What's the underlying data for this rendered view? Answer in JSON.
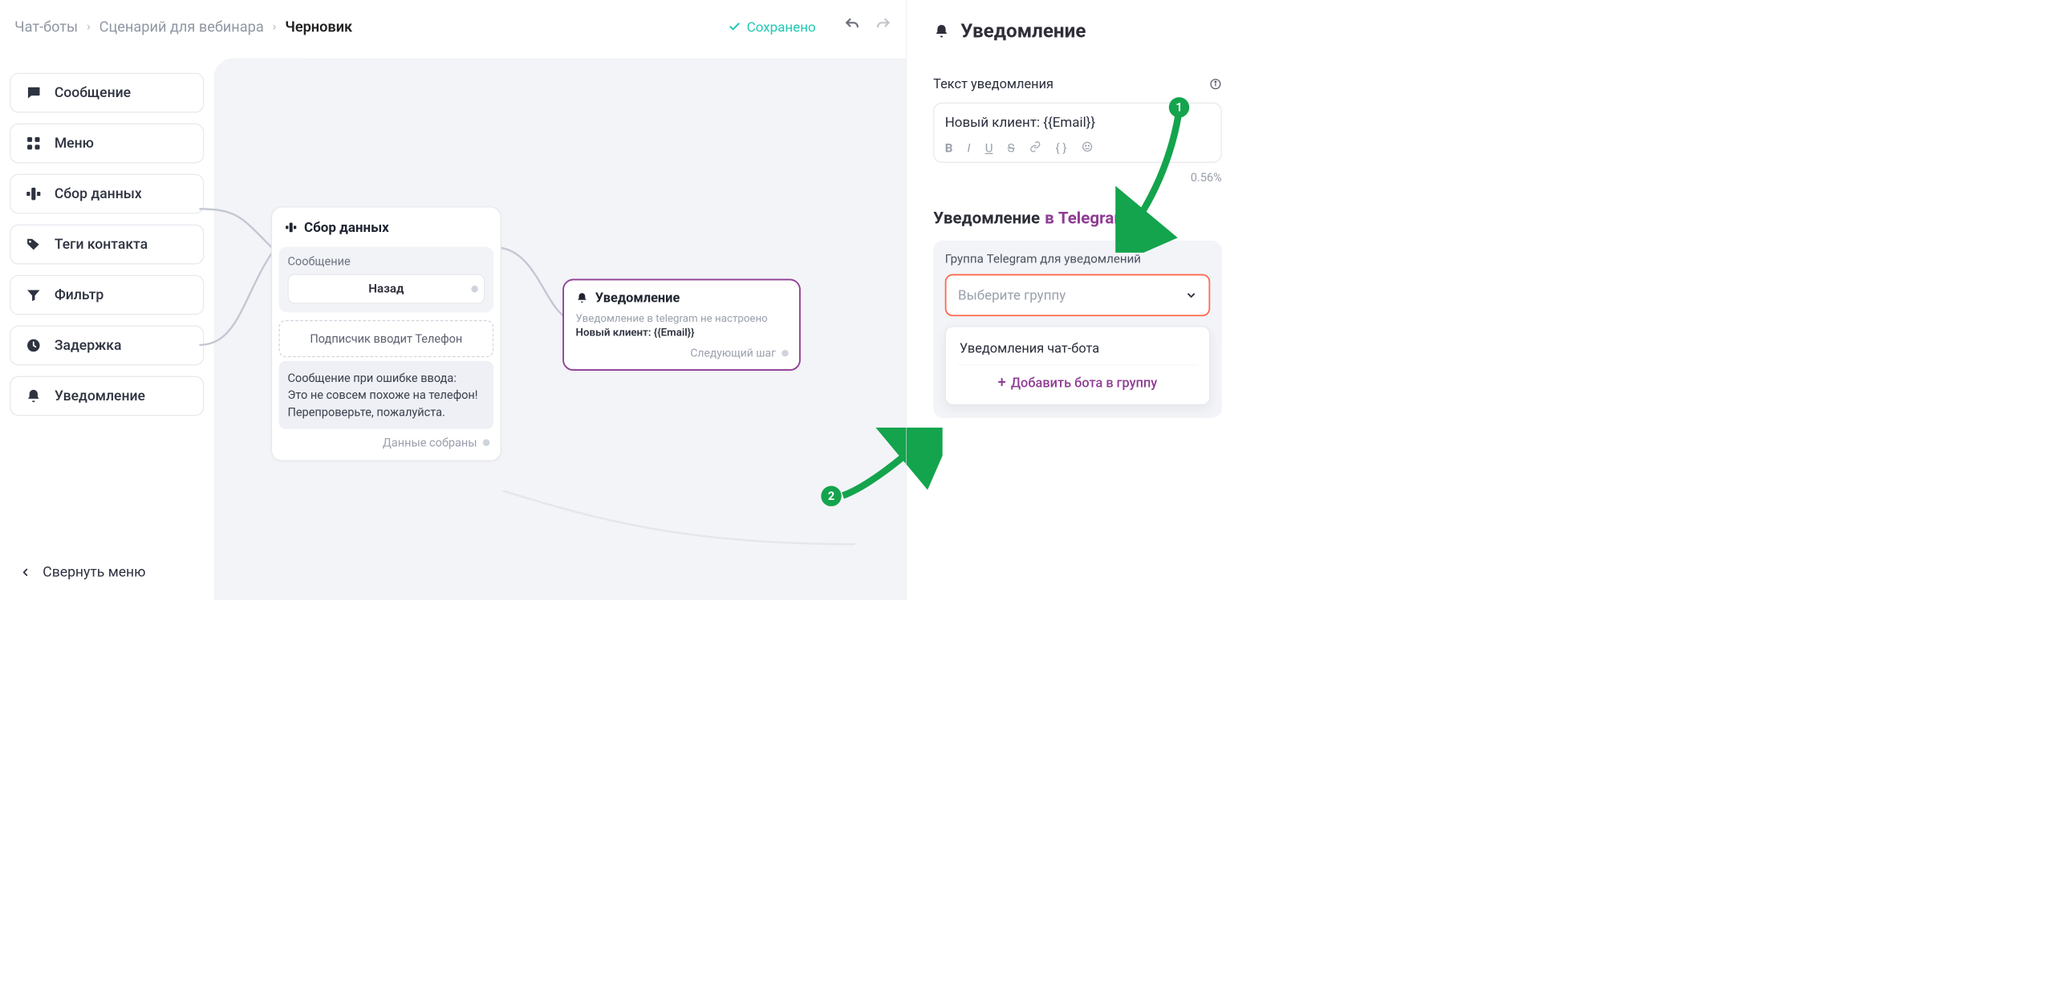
{
  "breadcrumb": {
    "item1": "Чат-боты",
    "item2": "Сценарий для вебинара",
    "item3": "Черновик"
  },
  "saved_label": "Сохранено",
  "sidebar": {
    "items": [
      {
        "label": "Сообщение"
      },
      {
        "label": "Меню"
      },
      {
        "label": "Сбор данных"
      },
      {
        "label": "Теги контакта"
      },
      {
        "label": "Фильтр"
      },
      {
        "label": "Задержка"
      },
      {
        "label": "Уведомление"
      }
    ],
    "collapse": "Свернуть меню"
  },
  "collector_node": {
    "title": "Сбор данных",
    "msg_label": "Сообщение",
    "back_button": "Назад",
    "prompt": "Подписчик вводит Телефон",
    "error_label": "Сообщение при ошибке ввода:",
    "error_text": "Это не совсем похоже на телефон! Перепроверьте, пожалуйста.",
    "footer": "Данные собраны"
  },
  "notify_node": {
    "title": "Уведомление",
    "warn": "Уведомление в telegram не настроено",
    "msg": "Новый клиент: {{Email}}",
    "footer": "Следующий шаг"
  },
  "panel": {
    "title": "Уведомление",
    "text_label": "Текст уведомления",
    "text_value": "Новый клиент: {{Email}}",
    "pct": "0.56%",
    "tg_heading_pre": "Уведомление ",
    "tg_heading_brand": "в Telegram",
    "group_label": "Группа Telegram для уведомлений",
    "select_placeholder": "Выберите группу",
    "dropdown_option": "Уведомления чат-бота",
    "add_bot": "Добавить бота в группу"
  },
  "callouts": {
    "one": "1",
    "two": "2"
  }
}
